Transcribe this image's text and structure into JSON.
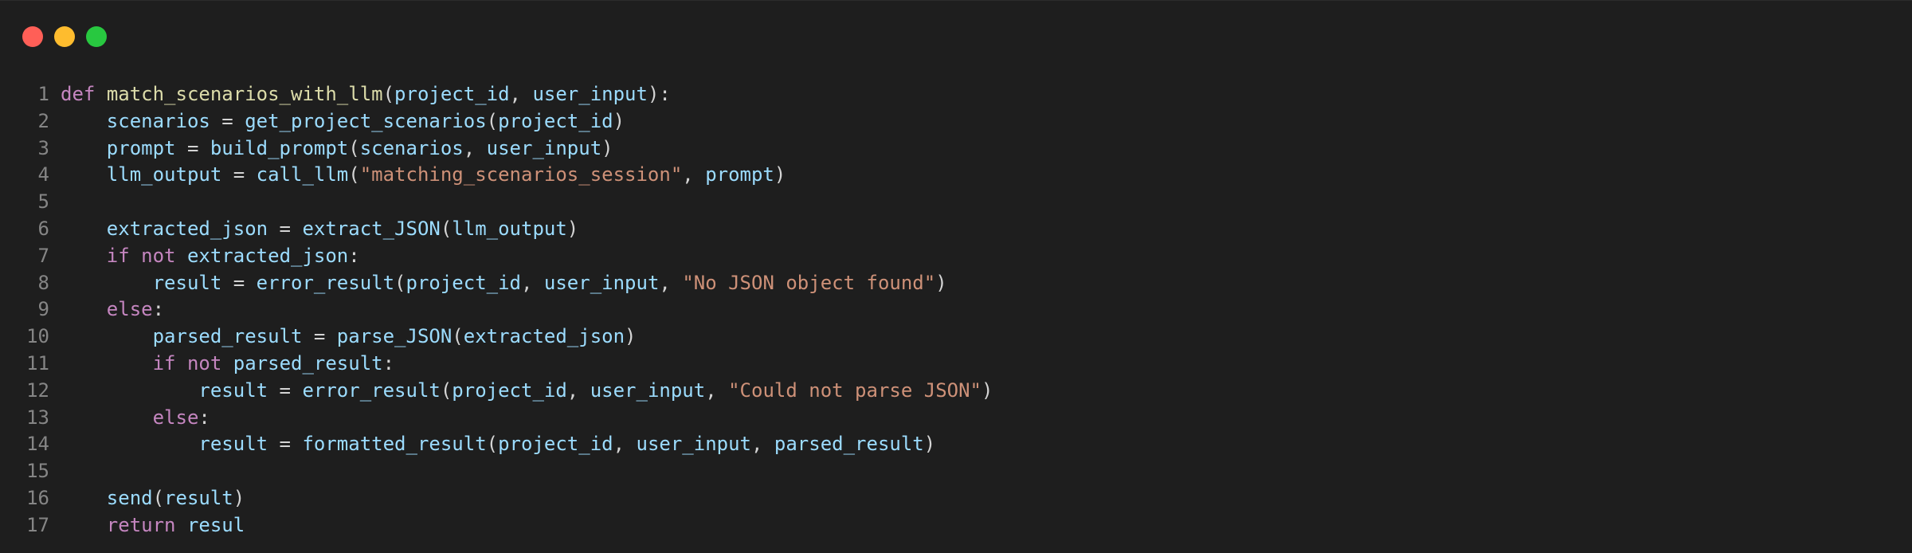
{
  "window": {
    "buttons": [
      {
        "name": "close",
        "color": "#ff5f57"
      },
      {
        "name": "minimize",
        "color": "#febc2e"
      },
      {
        "name": "maximize",
        "color": "#28c840"
      }
    ]
  },
  "code": {
    "lines": [
      {
        "n": "1",
        "tokens": [
          {
            "t": "keyword",
            "v": "def"
          },
          {
            "t": "ws",
            "v": " "
          },
          {
            "t": "function",
            "v": "match_scenarios_with_llm"
          },
          {
            "t": "punct",
            "v": "("
          },
          {
            "t": "ident",
            "v": "project_id"
          },
          {
            "t": "punct",
            "v": ", "
          },
          {
            "t": "ident",
            "v": "user_input"
          },
          {
            "t": "punct",
            "v": "):"
          }
        ]
      },
      {
        "n": "2",
        "tokens": [
          {
            "t": "ws",
            "v": "    "
          },
          {
            "t": "ident",
            "v": "scenarios"
          },
          {
            "t": "punct",
            "v": " = "
          },
          {
            "t": "ident",
            "v": "get_project_scenarios"
          },
          {
            "t": "punct",
            "v": "("
          },
          {
            "t": "ident",
            "v": "project_id"
          },
          {
            "t": "punct",
            "v": ")"
          }
        ]
      },
      {
        "n": "3",
        "tokens": [
          {
            "t": "ws",
            "v": "    "
          },
          {
            "t": "ident",
            "v": "prompt"
          },
          {
            "t": "punct",
            "v": " = "
          },
          {
            "t": "ident",
            "v": "build_prompt"
          },
          {
            "t": "punct",
            "v": "("
          },
          {
            "t": "ident",
            "v": "scenarios"
          },
          {
            "t": "punct",
            "v": ", "
          },
          {
            "t": "ident",
            "v": "user_input"
          },
          {
            "t": "punct",
            "v": ")"
          }
        ]
      },
      {
        "n": "4",
        "tokens": [
          {
            "t": "ws",
            "v": "    "
          },
          {
            "t": "ident",
            "v": "llm_output"
          },
          {
            "t": "punct",
            "v": " = "
          },
          {
            "t": "ident",
            "v": "call_llm"
          },
          {
            "t": "punct",
            "v": "("
          },
          {
            "t": "string",
            "v": "\"matching_scenarios_session\""
          },
          {
            "t": "punct",
            "v": ", "
          },
          {
            "t": "ident",
            "v": "prompt"
          },
          {
            "t": "punct",
            "v": ")"
          }
        ]
      },
      {
        "n": "5",
        "tokens": []
      },
      {
        "n": "6",
        "tokens": [
          {
            "t": "ws",
            "v": "    "
          },
          {
            "t": "ident",
            "v": "extracted_json"
          },
          {
            "t": "punct",
            "v": " = "
          },
          {
            "t": "ident",
            "v": "extract_JSON"
          },
          {
            "t": "punct",
            "v": "("
          },
          {
            "t": "ident",
            "v": "llm_output"
          },
          {
            "t": "punct",
            "v": ")"
          }
        ]
      },
      {
        "n": "7",
        "tokens": [
          {
            "t": "ws",
            "v": "    "
          },
          {
            "t": "keyword",
            "v": "if"
          },
          {
            "t": "ws",
            "v": " "
          },
          {
            "t": "keyword",
            "v": "not"
          },
          {
            "t": "ws",
            "v": " "
          },
          {
            "t": "ident",
            "v": "extracted_json"
          },
          {
            "t": "punct",
            "v": ":"
          }
        ]
      },
      {
        "n": "8",
        "tokens": [
          {
            "t": "ws",
            "v": "        "
          },
          {
            "t": "ident",
            "v": "result"
          },
          {
            "t": "punct",
            "v": " = "
          },
          {
            "t": "ident",
            "v": "error_result"
          },
          {
            "t": "punct",
            "v": "("
          },
          {
            "t": "ident",
            "v": "project_id"
          },
          {
            "t": "punct",
            "v": ", "
          },
          {
            "t": "ident",
            "v": "user_input"
          },
          {
            "t": "punct",
            "v": ", "
          },
          {
            "t": "string",
            "v": "\"No JSON object found\""
          },
          {
            "t": "punct",
            "v": ")"
          }
        ]
      },
      {
        "n": "9",
        "tokens": [
          {
            "t": "ws",
            "v": "    "
          },
          {
            "t": "keyword",
            "v": "else"
          },
          {
            "t": "punct",
            "v": ":"
          }
        ]
      },
      {
        "n": "10",
        "tokens": [
          {
            "t": "ws",
            "v": "        "
          },
          {
            "t": "ident",
            "v": "parsed_result"
          },
          {
            "t": "punct",
            "v": " = "
          },
          {
            "t": "ident",
            "v": "parse_JSON"
          },
          {
            "t": "punct",
            "v": "("
          },
          {
            "t": "ident",
            "v": "extracted_json"
          },
          {
            "t": "punct",
            "v": ")"
          }
        ]
      },
      {
        "n": "11",
        "tokens": [
          {
            "t": "ws",
            "v": "        "
          },
          {
            "t": "keyword",
            "v": "if"
          },
          {
            "t": "ws",
            "v": " "
          },
          {
            "t": "keyword",
            "v": "not"
          },
          {
            "t": "ws",
            "v": " "
          },
          {
            "t": "ident",
            "v": "parsed_result"
          },
          {
            "t": "punct",
            "v": ":"
          }
        ]
      },
      {
        "n": "12",
        "tokens": [
          {
            "t": "ws",
            "v": "            "
          },
          {
            "t": "ident",
            "v": "result"
          },
          {
            "t": "punct",
            "v": " = "
          },
          {
            "t": "ident",
            "v": "error_result"
          },
          {
            "t": "punct",
            "v": "("
          },
          {
            "t": "ident",
            "v": "project_id"
          },
          {
            "t": "punct",
            "v": ", "
          },
          {
            "t": "ident",
            "v": "user_input"
          },
          {
            "t": "punct",
            "v": ", "
          },
          {
            "t": "string",
            "v": "\"Could not parse JSON\""
          },
          {
            "t": "punct",
            "v": ")"
          }
        ]
      },
      {
        "n": "13",
        "tokens": [
          {
            "t": "ws",
            "v": "        "
          },
          {
            "t": "keyword",
            "v": "else"
          },
          {
            "t": "punct",
            "v": ":"
          }
        ]
      },
      {
        "n": "14",
        "tokens": [
          {
            "t": "ws",
            "v": "            "
          },
          {
            "t": "ident",
            "v": "result"
          },
          {
            "t": "punct",
            "v": " = "
          },
          {
            "t": "ident",
            "v": "formatted_result"
          },
          {
            "t": "punct",
            "v": "("
          },
          {
            "t": "ident",
            "v": "project_id"
          },
          {
            "t": "punct",
            "v": ", "
          },
          {
            "t": "ident",
            "v": "user_input"
          },
          {
            "t": "punct",
            "v": ", "
          },
          {
            "t": "ident",
            "v": "parsed_result"
          },
          {
            "t": "punct",
            "v": ")"
          }
        ]
      },
      {
        "n": "15",
        "tokens": []
      },
      {
        "n": "16",
        "tokens": [
          {
            "t": "ws",
            "v": "    "
          },
          {
            "t": "ident",
            "v": "send"
          },
          {
            "t": "punct",
            "v": "("
          },
          {
            "t": "ident",
            "v": "result"
          },
          {
            "t": "punct",
            "v": ")"
          }
        ]
      },
      {
        "n": "17",
        "tokens": [
          {
            "t": "ws",
            "v": "    "
          },
          {
            "t": "keyword",
            "v": "return"
          },
          {
            "t": "ws",
            "v": " "
          },
          {
            "t": "ident",
            "v": "resul"
          }
        ]
      }
    ]
  }
}
